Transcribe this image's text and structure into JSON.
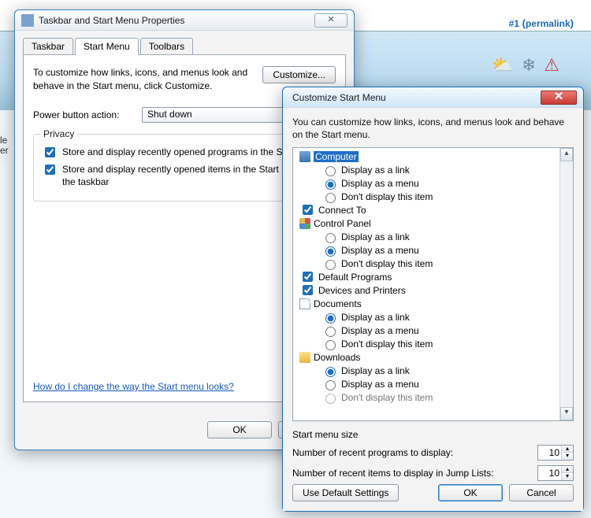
{
  "page_header": {
    "num": "#1",
    "permalink_text": "permalink"
  },
  "win1": {
    "title": "Taskbar and Start Menu Properties",
    "close_glyph": "✕",
    "tabs": {
      "taskbar": "Taskbar",
      "start_menu": "Start Menu",
      "toolbars": "Toolbars"
    },
    "intro": "To customize how links, icons, and menus look and behave in the Start menu, click Customize.",
    "customize_btn": "Customize...",
    "power_label": "Power button action:",
    "power_value": "Shut down",
    "privacy_legend": "Privacy",
    "privacy_opt1": "Store and display recently opened programs in the Start menu",
    "privacy_opt2": "Store and display recently opened items in the Start menu and the taskbar",
    "help_link": "How do I change the way the Start menu looks?",
    "ok": "OK",
    "cancel": "Cancel"
  },
  "win2": {
    "title": "Customize Start Menu",
    "close_glyph": "✕",
    "intro": "You can customize how links, icons, and menus look and behave on the Start menu.",
    "tree": {
      "computer": {
        "label": "Computer",
        "opt_link": "Display as a link",
        "opt_menu": "Display as a menu",
        "opt_none": "Don't display this item",
        "selected": "menu"
      },
      "connect_to": {
        "label": "Connect To",
        "checked": true
      },
      "control_panel": {
        "label": "Control Panel",
        "opt_link": "Display as a link",
        "opt_menu": "Display as a menu",
        "opt_none": "Don't display this item",
        "selected": "menu"
      },
      "default_programs": {
        "label": "Default Programs",
        "checked": true
      },
      "devices_printers": {
        "label": "Devices and Printers",
        "checked": true
      },
      "documents": {
        "label": "Documents",
        "opt_link": "Display as a link",
        "opt_menu": "Display as a menu",
        "opt_none": "Don't display this item",
        "selected": "link"
      },
      "downloads": {
        "label": "Downloads",
        "opt_link": "Display as a link",
        "opt_menu": "Display as a menu",
        "opt_none": "Don't display this item",
        "selected": "link"
      }
    },
    "size_heading": "Start menu size",
    "recent_programs_label": "Number of recent programs to display:",
    "recent_programs_value": "10",
    "jump_lists_label": "Number of recent items to display in Jump Lists:",
    "jump_lists_value": "10",
    "use_defaults": "Use Default Settings",
    "ok": "OK",
    "cancel": "Cancel"
  }
}
